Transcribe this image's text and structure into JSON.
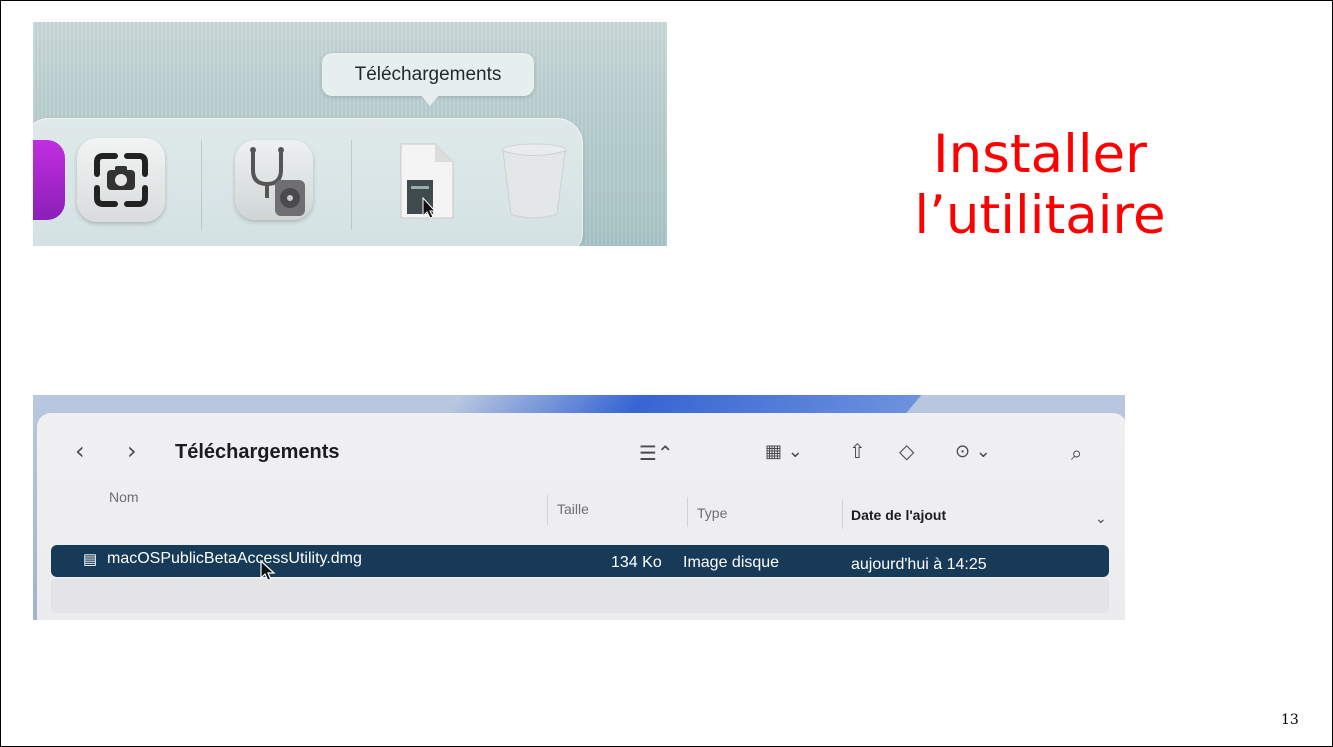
{
  "slide": {
    "title": "Installer\nl’utilitaire",
    "page_number": "13"
  },
  "dock": {
    "tooltip": "Téléchargements",
    "items": [
      "screenshot-app-icon",
      "disk-utility-icon",
      "downloads-stack-icon",
      "trash-icon"
    ]
  },
  "finder": {
    "window_title": "Téléchargements",
    "columns": {
      "name": "Nom",
      "size": "Taille",
      "type": "Type",
      "date_added": "Date de l'ajout"
    },
    "rows": [
      {
        "name": "macOSPublicBetaAccessUtility.dmg",
        "size": "134 Ko",
        "type": "Image disque",
        "date_added": "aujourd'hui à 14:25",
        "selected": true
      }
    ]
  },
  "colors": {
    "title": "#ff0000",
    "selection": "#163a57"
  }
}
